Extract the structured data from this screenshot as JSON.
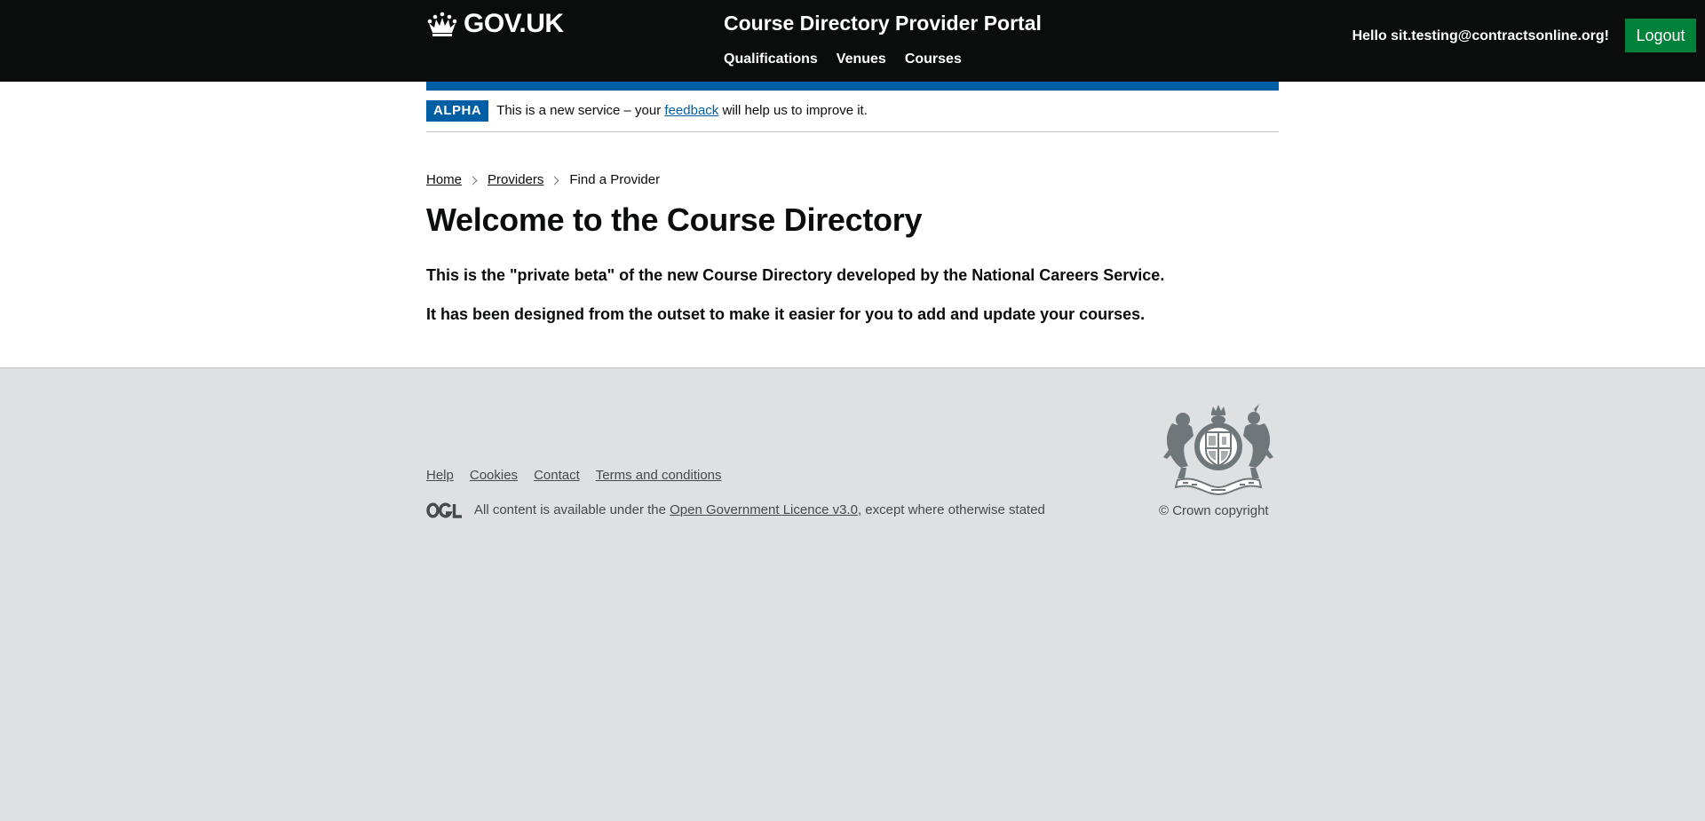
{
  "header": {
    "logo_text": "GOV.UK",
    "service_name": "Course Directory Provider Portal",
    "nav": [
      {
        "label": "Qualifications"
      },
      {
        "label": "Venues"
      },
      {
        "label": "Courses"
      }
    ],
    "greeting": "Hello sit.testing@contractsonline.org!",
    "logout_label": "Logout"
  },
  "phase_banner": {
    "tag": "ALPHA",
    "text_before": "This is a new service – your ",
    "link": "feedback",
    "text_after": " will help us to improve it."
  },
  "breadcrumbs": {
    "home": "Home",
    "providers": "Providers",
    "current": "Find a Provider"
  },
  "main": {
    "title": "Welcome to the Course Directory",
    "paragraphs": [
      "This is the \"private beta\" of the new Course Directory developed by the National Careers Service.",
      "It has been designed from the outset to make it easier for you to add and update your courses."
    ]
  },
  "footer": {
    "links": [
      {
        "label": "Help"
      },
      {
        "label": "Cookies"
      },
      {
        "label": "Contact"
      },
      {
        "label": "Terms and conditions"
      }
    ],
    "licence_before": "All content is available under the ",
    "licence_link": "Open Government Licence v3.0",
    "licence_after": ", except where otherwise stated",
    "copyright": "© Crown copyright",
    "crest_text": [
      "DIEU ET MON DROIT",
      "HONI SOIT QUI MAL Y PENSE"
    ]
  },
  "icons": {
    "crown": "crown-icon",
    "chevron": "chevron-right-icon",
    "ogl": "ogl-logo-icon",
    "crest": "royal-coat-of-arms-icon"
  },
  "colors": {
    "header_bg": "#0b0c0c",
    "brand_blue": "#005ea5",
    "logout_green": "#00823b",
    "footer_bg": "#dee0e2"
  }
}
